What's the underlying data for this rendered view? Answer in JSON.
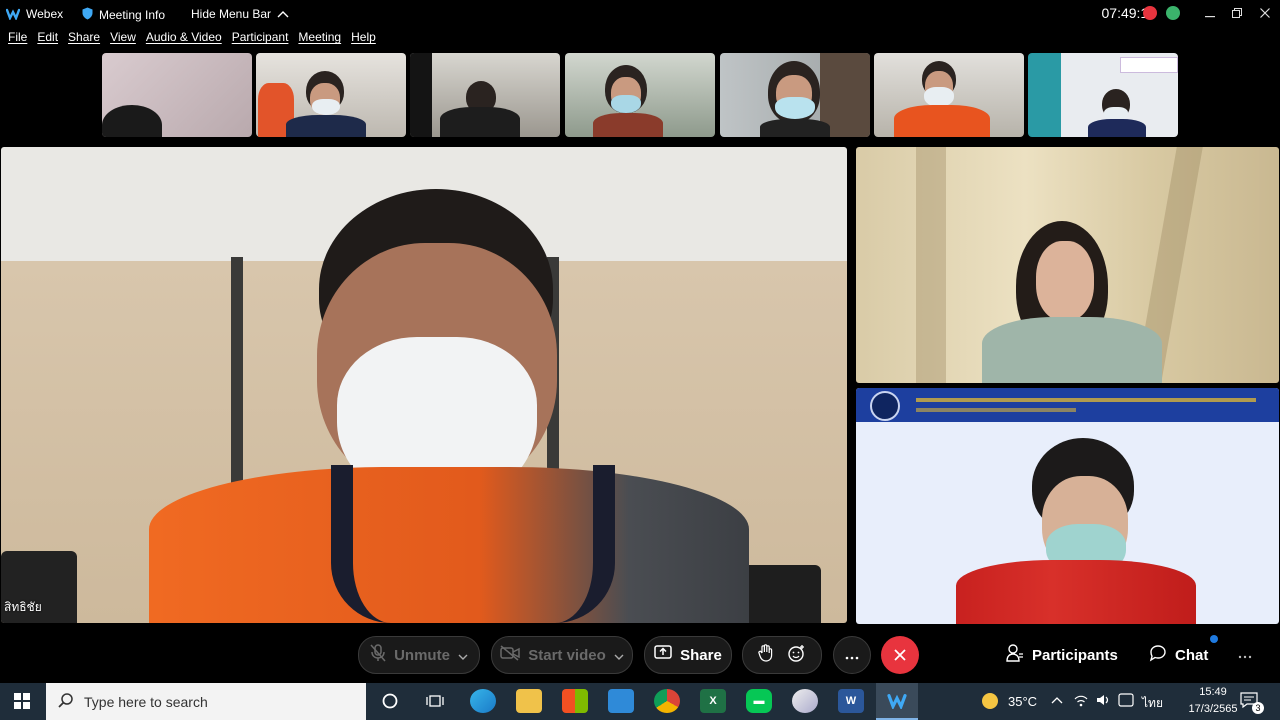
{
  "titlebar": {
    "app_name": "Webex",
    "meeting_info": "Meeting Info",
    "hide_menu_bar": "Hide Menu Bar",
    "clock": "07:49:17"
  },
  "menu": [
    "File",
    "Edit",
    "Share",
    "View",
    "Audio & Video",
    "Participant",
    "Meeting",
    "Help"
  ],
  "main_video": {
    "name_label": "สิทธิชัย"
  },
  "controls": {
    "unmute": "Unmute",
    "start_video": "Start video",
    "share": "Share",
    "participants": "Participants",
    "chat": "Chat"
  },
  "taskbar": {
    "search_placeholder": "Type here to search",
    "temperature": "35°C",
    "language": "ไทย",
    "time": "15:49",
    "date": "17/3/2565",
    "notification_count": "3"
  },
  "colors": {
    "background": "#000000",
    "leave_red": "#e8343e",
    "taskbar": "#1f2d3a",
    "chat_dot": "#1f7ae0"
  }
}
